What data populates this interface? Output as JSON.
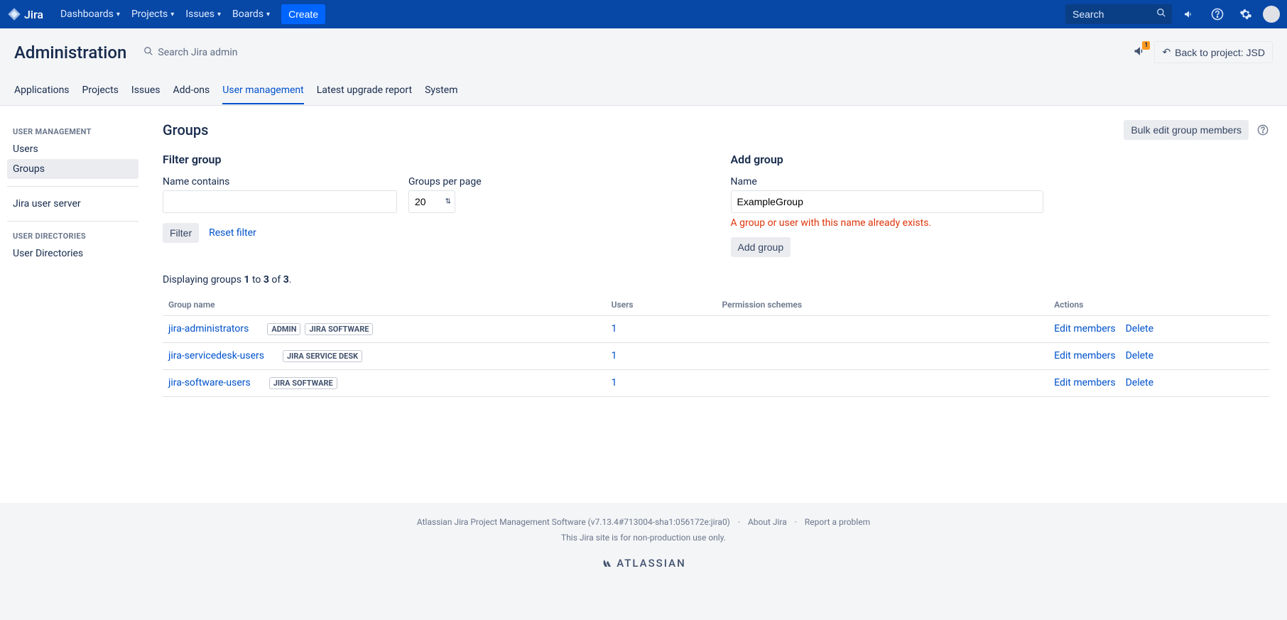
{
  "topbar": {
    "logo_text": "Jira",
    "nav": [
      "Dashboards",
      "Projects",
      "Issues",
      "Boards"
    ],
    "create_label": "Create",
    "search_placeholder": "Search"
  },
  "admin_header": {
    "title": "Administration",
    "search_label": "Search Jira admin",
    "back_label": "Back to project: JSD",
    "feedback_badge": "1"
  },
  "admin_tabs": [
    "Applications",
    "Projects",
    "Issues",
    "Add-ons",
    "User management",
    "Latest upgrade report",
    "System"
  ],
  "admin_tabs_active_index": 4,
  "sidebar": {
    "sections": [
      {
        "label": "USER MANAGEMENT",
        "items": [
          "Users",
          "Groups"
        ],
        "active_index": 1
      },
      {
        "items": [
          "Jira user server"
        ]
      },
      {
        "label": "USER DIRECTORIES",
        "items": [
          "User Directories"
        ]
      }
    ]
  },
  "content": {
    "title": "Groups",
    "bulk_button": "Bulk edit group members",
    "filter": {
      "heading": "Filter group",
      "name_label": "Name contains",
      "perpage_label": "Groups per page",
      "perpage_value": "20",
      "filter_btn": "Filter",
      "reset_link": "Reset filter"
    },
    "add": {
      "heading": "Add group",
      "name_label": "Name",
      "name_value": "ExampleGroup",
      "error": "A group or user with this name already exists.",
      "add_btn": "Add group"
    },
    "display_text_prefix": "Displaying groups ",
    "display_from": "1",
    "display_to_word": " to ",
    "display_to": "3",
    "display_of_word": " of ",
    "display_total": "3",
    "display_suffix": ".",
    "table": {
      "headers": [
        "Group name",
        "Users",
        "Permission schemes",
        "Actions"
      ],
      "rows": [
        {
          "name": "jira-administrators",
          "badges": [
            "ADMIN",
            "JIRA SOFTWARE"
          ],
          "users": "1",
          "schemes": "",
          "actions": [
            "Edit members",
            "Delete"
          ]
        },
        {
          "name": "jira-servicedesk-users",
          "badges": [
            "JIRA SERVICE DESK"
          ],
          "users": "1",
          "schemes": "",
          "actions": [
            "Edit members",
            "Delete"
          ]
        },
        {
          "name": "jira-software-users",
          "badges": [
            "JIRA SOFTWARE"
          ],
          "users": "1",
          "schemes": "",
          "actions": [
            "Edit members",
            "Delete"
          ]
        }
      ]
    }
  },
  "footer": {
    "line1": "Atlassian Jira Project Management Software (v7.13.4#713004-sha1:056172e:jira0)",
    "about": "About Jira",
    "report": "Report a problem",
    "line2": "This Jira site is for non-production use only.",
    "brand": "ATLASSIAN"
  }
}
